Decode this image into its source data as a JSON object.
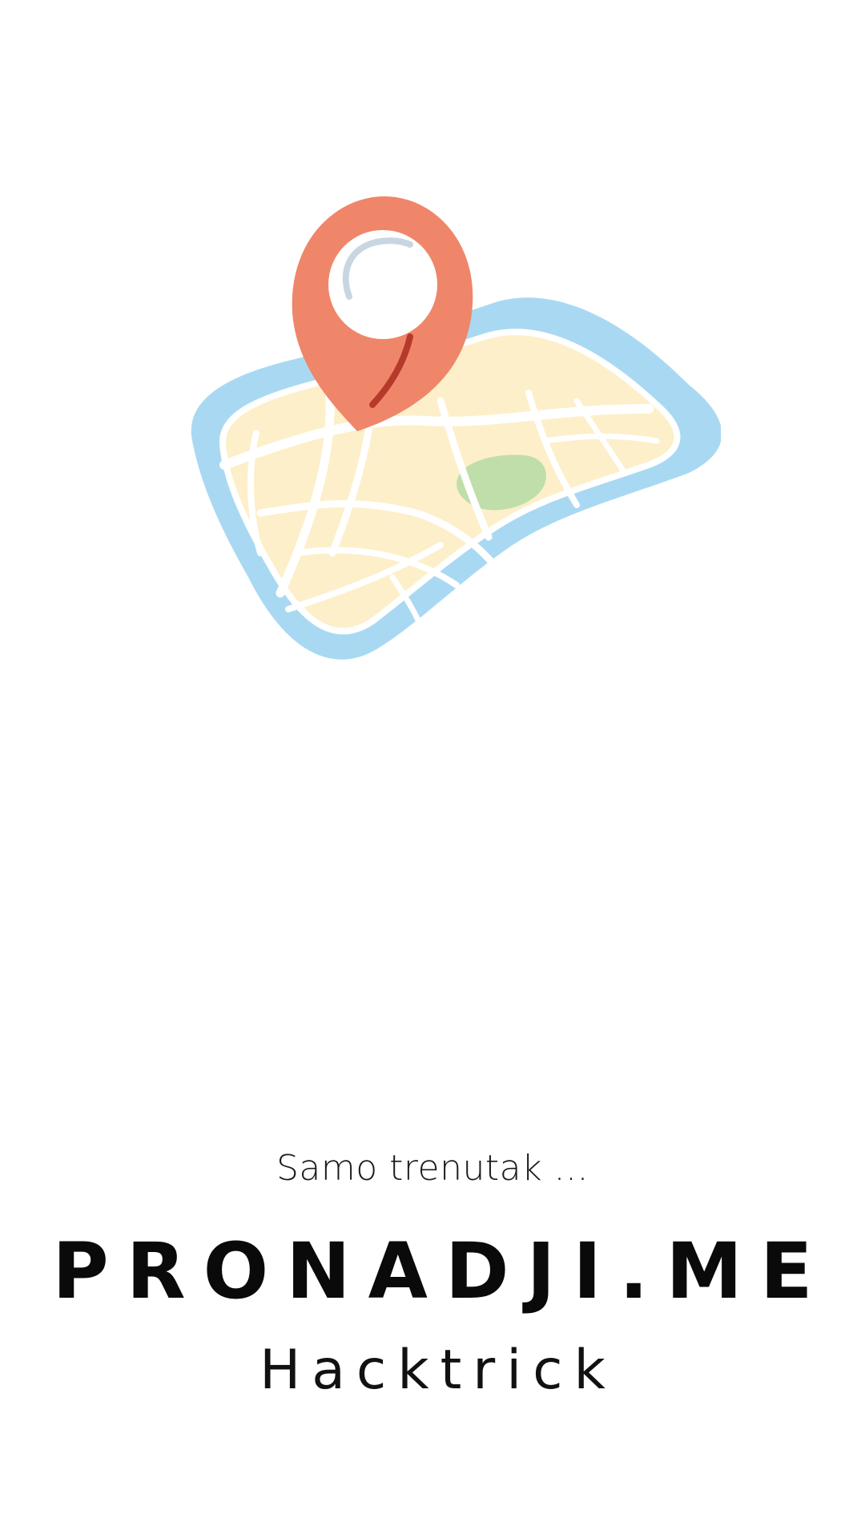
{
  "screen": {
    "background": "#ffffff"
  },
  "illustration": {
    "icon": "map-with-location-pin",
    "colors": {
      "pin": "#ef866a",
      "pin_highlight": "#b53a2a",
      "map_border": "#a9d9f2",
      "map_fill": "#fdefc9",
      "park": "#bfdeaa",
      "roads": "#ffffff"
    }
  },
  "loading": {
    "text": "Samo trenutak ..."
  },
  "brand": {
    "title": "PRONADJI.ME",
    "subtitle": "Hacktrick"
  }
}
